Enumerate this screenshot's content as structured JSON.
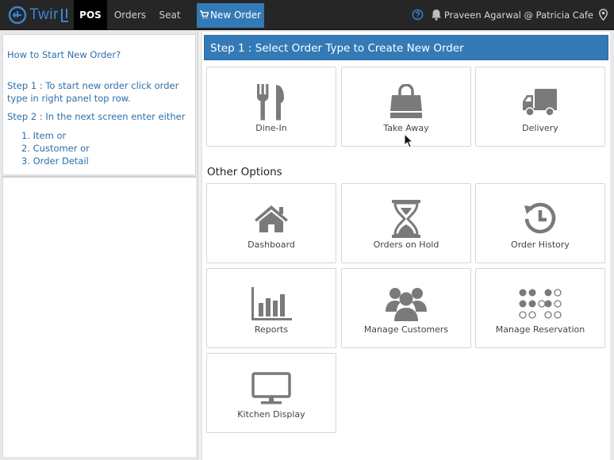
{
  "nav": {
    "brand": "Twir",
    "pos": "POS",
    "orders": "Orders",
    "seat": "Seat",
    "new_order": "New Order",
    "user": "Praveen Agarwal @ Patricia Cafe"
  },
  "help": {
    "title": "How to Start New Order?",
    "step1_a": "Step 1 : To start new order click order",
    "step1_b": "type in right panel top row.",
    "step2": "Step 2 : In the next screen enter either",
    "options": [
      "1. Item or",
      "2. Customer or",
      "3. Order Detail"
    ]
  },
  "main": {
    "step_title": "Step 1 : Select Order Type to Create New Order",
    "order_types": [
      {
        "label": "Dine-In",
        "icon": "fork-knife-icon"
      },
      {
        "label": "Take Away",
        "icon": "shopping-bag-icon"
      },
      {
        "label": "Delivery",
        "icon": "truck-icon"
      }
    ],
    "other_title": "Other Options",
    "other_options": [
      {
        "label": "Dashboard",
        "icon": "home-icon"
      },
      {
        "label": "Orders on Hold",
        "icon": "hourglass-icon"
      },
      {
        "label": "Order History",
        "icon": "history-icon"
      },
      {
        "label": "Reports",
        "icon": "bar-chart-icon"
      },
      {
        "label": "Manage Customers",
        "icon": "users-icon"
      },
      {
        "label": "Manage Reservation",
        "icon": "reservation-grid-icon"
      },
      {
        "label": "Kitchen Display",
        "icon": "monitor-icon"
      }
    ]
  },
  "colors": {
    "accent": "#337ab7",
    "nav_bg": "#262626",
    "icon": "#7a7a7a",
    "help_text": "#2d6fa9"
  }
}
